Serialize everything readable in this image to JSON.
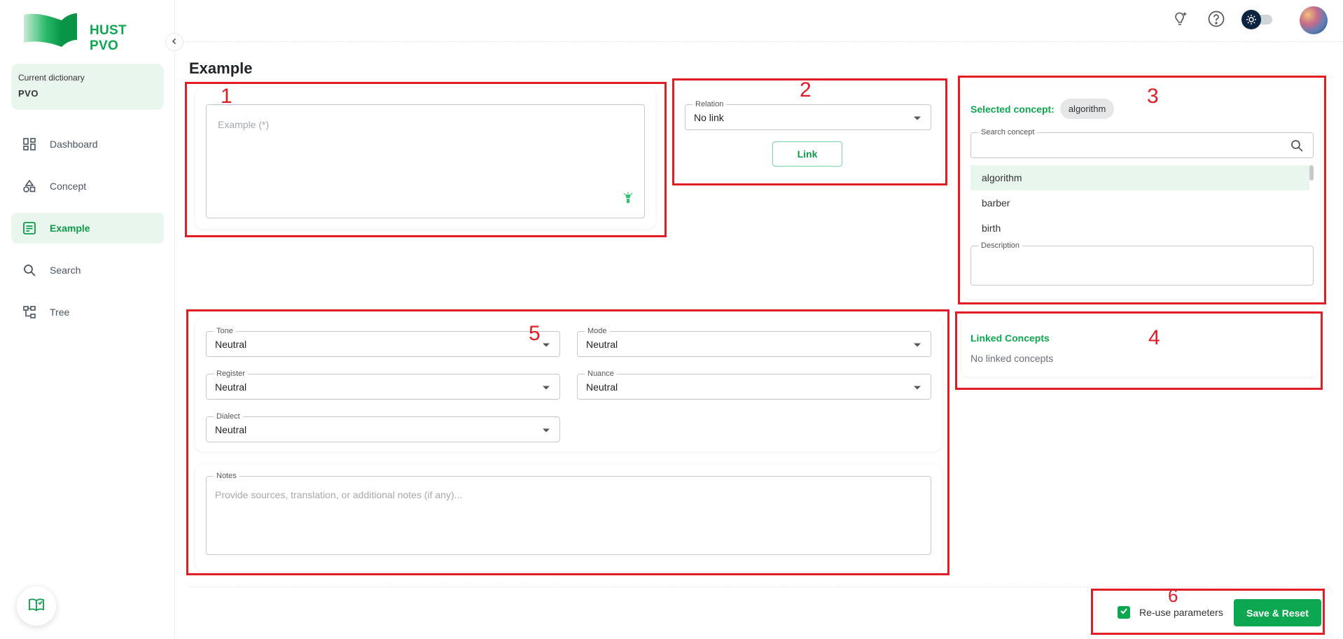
{
  "app": {
    "name": "HUST PVO"
  },
  "sidebar": {
    "dictionary_label": "Current dictionary",
    "dictionary_value": "PVO",
    "items": [
      {
        "label": "Dashboard",
        "icon": "dashboard-icon"
      },
      {
        "label": "Concept",
        "icon": "shapes-icon"
      },
      {
        "label": "Example",
        "icon": "note-icon",
        "active": true
      },
      {
        "label": "Search",
        "icon": "search-icon"
      },
      {
        "label": "Tree",
        "icon": "tree-icon"
      }
    ]
  },
  "page": {
    "title": "Example"
  },
  "example": {
    "placeholder": "Example (*)"
  },
  "relation": {
    "label": "Relation",
    "value": "No link",
    "button": "Link"
  },
  "concept_panel": {
    "selected_label": "Selected concept:",
    "selected_value": "algorithm",
    "search_label": "Search concept",
    "items": [
      "algorithm",
      "barber",
      "birth"
    ],
    "description_label": "Description"
  },
  "linked": {
    "title": "Linked Concepts",
    "empty": "No linked concepts"
  },
  "params": {
    "tone": {
      "label": "Tone",
      "value": "Neutral"
    },
    "mode": {
      "label": "Mode",
      "value": "Neutral"
    },
    "register": {
      "label": "Register",
      "value": "Neutral"
    },
    "nuance": {
      "label": "Nuance",
      "value": "Neutral"
    },
    "dialect": {
      "label": "Dialect",
      "value": "Neutral"
    }
  },
  "notes": {
    "label": "Notes",
    "placeholder": "Provide sources, translation, or additional notes (if any)..."
  },
  "footer": {
    "reuse_label": "Re-use parameters",
    "reuse_checked": true,
    "save_button": "Save & Reset"
  },
  "annotations": [
    "1",
    "2",
    "3",
    "4",
    "5",
    "6"
  ],
  "colors": {
    "brand": "#0ea751",
    "annotation": "#e01c24",
    "active_bg": "#e8f6ee"
  }
}
